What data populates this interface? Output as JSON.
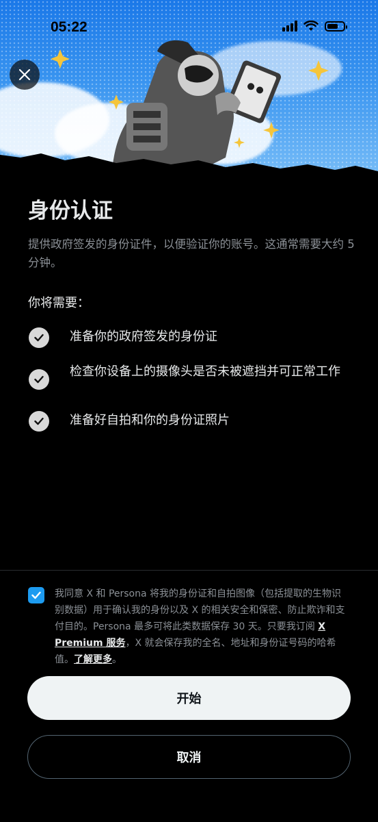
{
  "status_bar": {
    "time": "05:22",
    "battery_level": 0.7
  },
  "hero": {
    "image": "astronaut-illustration",
    "accent_colors": [
      "#1a78e8",
      "#f5c53a"
    ]
  },
  "title": "身份认证",
  "subtitle": "提供政府签发的身份证件，以便验证你的账号。这通常需要大约 5 分钟。",
  "needs_heading": "你将需要：",
  "requirements": [
    {
      "label": "准备你的政府签发的身份证"
    },
    {
      "label": "检查你设备上的摄像头是否未被遮挡并可正常工作"
    },
    {
      "label": "准备好自拍和你的身份证照片"
    }
  ],
  "consent": {
    "checked": true,
    "text_before": "我同意 X 和 Persona 将我的身份证和自拍图像（包括提取的生物识别数据）用于确认我的身份以及 X 的相关安全和保密、防止欺诈和支付目的。Persona 最多可将此类数据保存 30 天。只要我订阅 ",
    "premium_link": "X Premium 服务",
    "text_middle": "，X 就会保存我的全名、地址和身份证号码的哈希值。",
    "learn_more_link": "了解更多",
    "text_end": "。"
  },
  "buttons": {
    "start": "开始",
    "cancel": "取消"
  },
  "colors": {
    "accent": "#1d9bf0",
    "background": "#000000",
    "text": "#e7e9ea",
    "muted": "#8b9096"
  }
}
